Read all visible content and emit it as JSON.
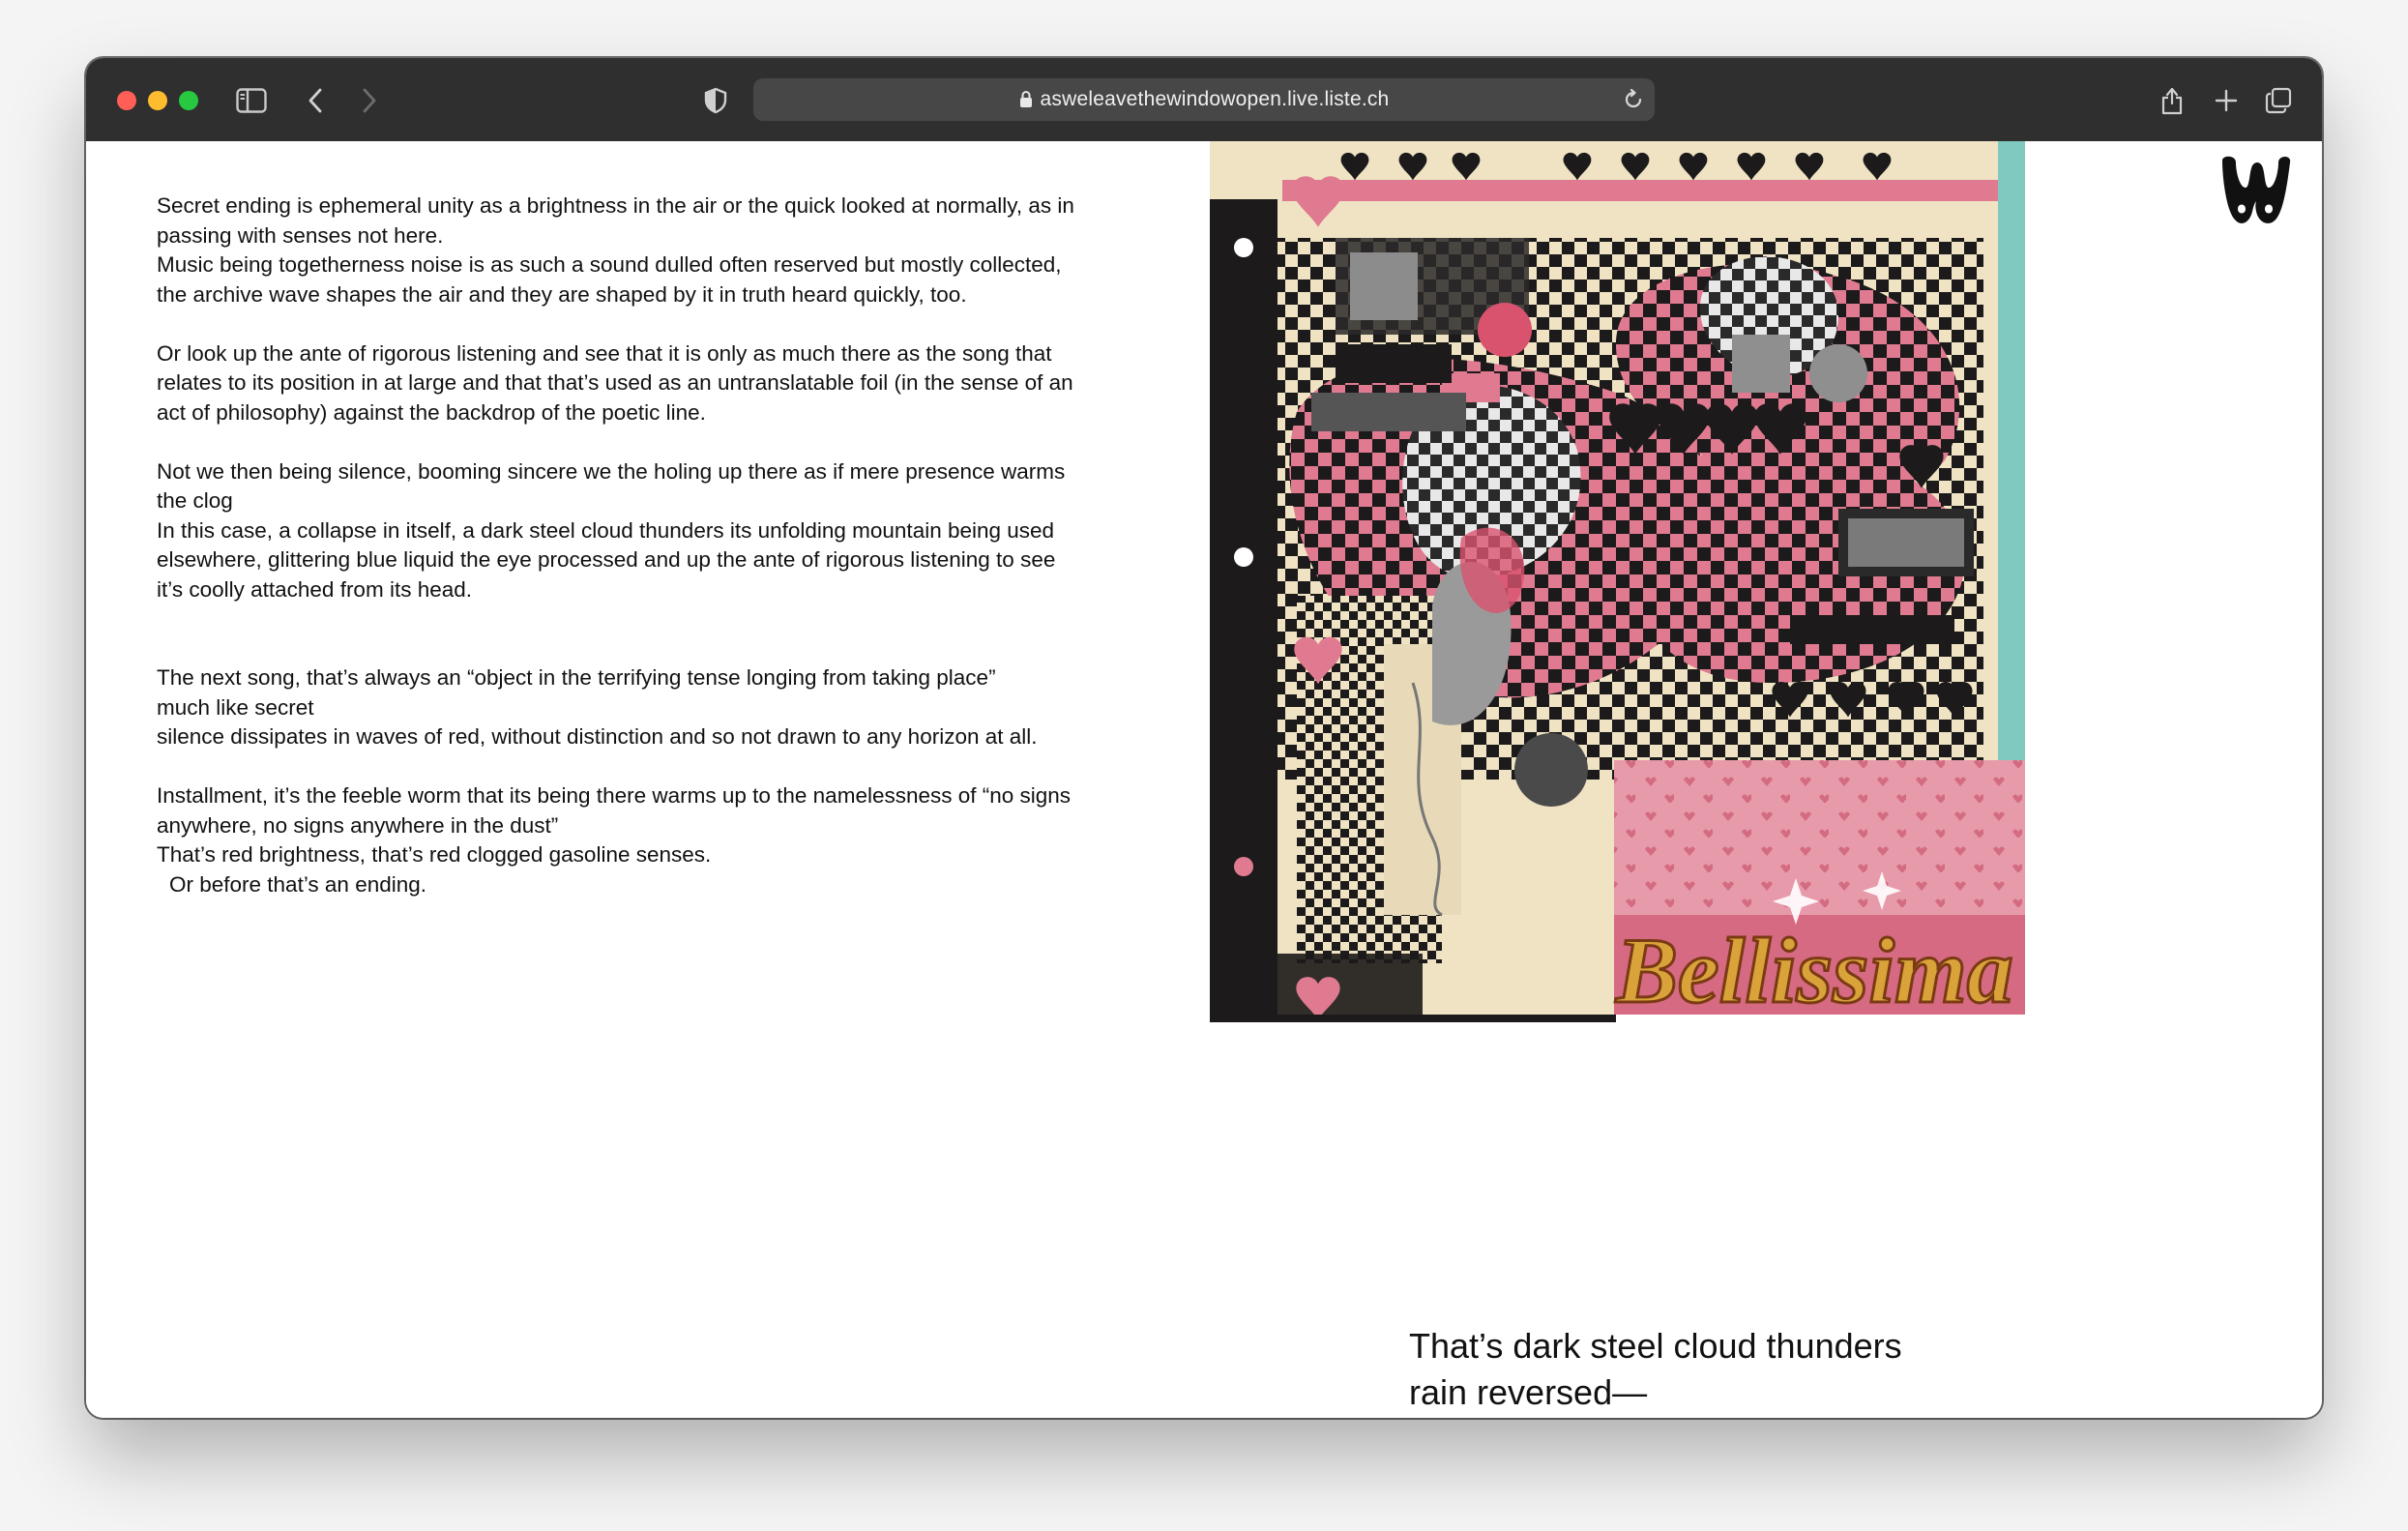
{
  "browser": {
    "url": "asweleavethewindowopen.live.liste.ch",
    "icons": [
      "sidebar-icon",
      "back-icon",
      "forward-icon",
      "privacy-shield-icon",
      "lock-icon",
      "reload-icon",
      "share-icon",
      "new-tab-icon",
      "tabs-overview-icon"
    ]
  },
  "poem": {
    "lines": [
      "Secret ending is ephemeral unity as a brightness in the air or the quick looked at normally, as in",
      "passing with senses not here.",
      "Music being togetherness noise is as such a sound dulled often reserved but mostly collected,",
      "the archive wave shapes the air and they are shaped by it in truth heard quickly, too.",
      "Or look up the ante of rigorous listening and see that it is only as much there as the song that",
      "relates to its position in at large and that that’s used as an untranslatable foil (in the sense of an",
      "act of philosophy) against the backdrop of the poetic line.",
      "Not we then being silence, booming sincere we the holing up there as if mere presence warms",
      "the clog",
      "In this case, a collapse in itself, a dark steel cloud thunders its unfolding mountain being used",
      "elsewhere, glittering blue liquid the eye processed and up the ante of rigorous listening to see",
      "it’s coolly attached from its head.",
      "The next song, that’s always an “object in the terrifying tense longing from taking place”",
      "much like secret",
      "silence dissipates in waves of red, without distinction and so not drawn to any horizon at all.",
      "Installment, it’s the feeble worm that its being there warms up to the namelessness of “no signs",
      "anywhere, no signs anywhere in the dust”",
      "That’s red brightness, that’s red clogged gasoline senses.",
      "Or before that’s an ending."
    ]
  },
  "artwork": {
    "text": "Bellissima",
    "colors": {
      "pink": "#e07a90",
      "black": "#1c1a1a",
      "cream": "#efe3c4",
      "teal": "#7fc9c0",
      "gold": "#d9a33a"
    }
  },
  "caption": {
    "line1": "That’s dark steel cloud thunders",
    "line2": "rain reversed—"
  }
}
